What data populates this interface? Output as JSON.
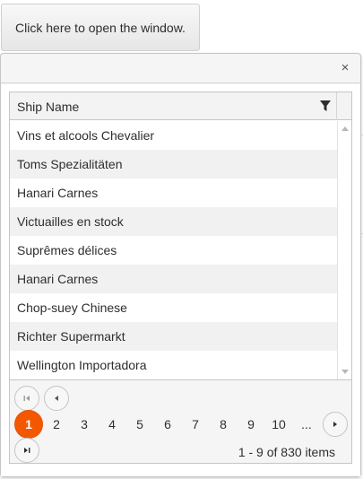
{
  "open_button": {
    "label": "Click here to open the window."
  },
  "window": {
    "close_glyph": "×",
    "grid": {
      "column_header": "Ship Name",
      "rows": [
        "Vins et alcools Chevalier",
        "Toms Spezialitäten",
        "Hanari Carnes",
        "Victuailles en stock",
        "Suprêmes délices",
        "Hanari Carnes",
        "Chop-suey Chinese",
        "Richter Supermarkt",
        "Wellington Importadora"
      ]
    },
    "pager": {
      "pages": [
        "1",
        "2",
        "3",
        "4",
        "5",
        "6",
        "7",
        "8",
        "9",
        "10",
        "..."
      ],
      "current_page": "1",
      "info": "1 - 9 of 830 items"
    }
  },
  "background_page": {
    "glyphs": [
      "r",
      "r",
      "r",
      "n"
    ]
  },
  "colors": {
    "accent": "#f35800",
    "row_alt": "#f1f1f1",
    "border": "#c5c5c5"
  }
}
